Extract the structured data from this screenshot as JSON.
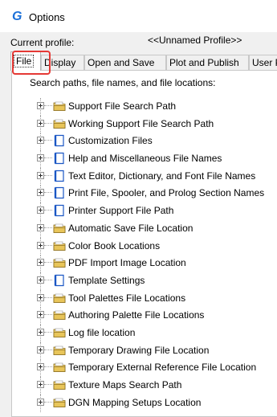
{
  "window": {
    "title": "Options",
    "app_icon": "G"
  },
  "profile": {
    "label": "Current profile:",
    "value": "<<Unnamed Profile>>"
  },
  "tabs": [
    {
      "label": "File",
      "active": true
    },
    {
      "label": "Display"
    },
    {
      "label": "Open and Save"
    },
    {
      "label": "Plot and Publish"
    },
    {
      "label": "User P"
    }
  ],
  "panel": {
    "label": "Search paths, file names, and file locations:"
  },
  "tree": [
    {
      "label": "Support File Search Path",
      "icon": "folder"
    },
    {
      "label": "Working Support File Search Path",
      "icon": "folder"
    },
    {
      "label": "Customization Files",
      "icon": "file"
    },
    {
      "label": "Help and Miscellaneous File Names",
      "icon": "file"
    },
    {
      "label": "Text Editor, Dictionary, and Font File Names",
      "icon": "file"
    },
    {
      "label": "Print File, Spooler, and Prolog Section Names",
      "icon": "file"
    },
    {
      "label": "Printer Support File Path",
      "icon": "file"
    },
    {
      "label": "Automatic Save File Location",
      "icon": "folder"
    },
    {
      "label": "Color Book Locations",
      "icon": "folder"
    },
    {
      "label": "PDF Import Image Location",
      "icon": "folder"
    },
    {
      "label": "Template Settings",
      "icon": "file"
    },
    {
      "label": "Tool Palettes File Locations",
      "icon": "folder"
    },
    {
      "label": "Authoring Palette File Locations",
      "icon": "folder"
    },
    {
      "label": "Log file location",
      "icon": "folder"
    },
    {
      "label": "Temporary Drawing File Location",
      "icon": "folder"
    },
    {
      "label": "Temporary External Reference File Location",
      "icon": "folder"
    },
    {
      "label": "Texture Maps Search Path",
      "icon": "folder"
    },
    {
      "label": "DGN Mapping Setups Location",
      "icon": "folder"
    }
  ],
  "colors": {
    "highlight": "#e53935",
    "app_icon": "#1a6fd8"
  }
}
